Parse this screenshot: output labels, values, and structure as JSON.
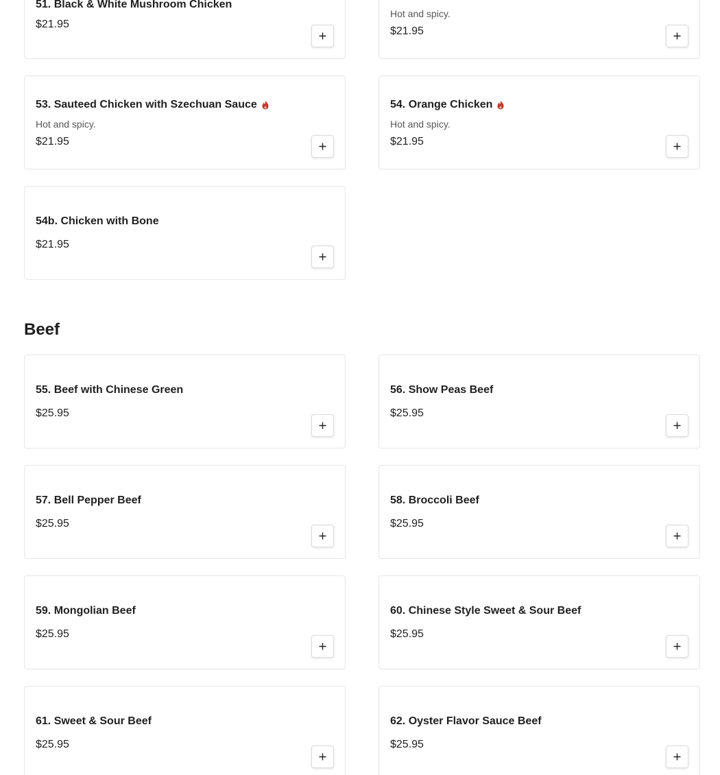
{
  "colors": {
    "spicy": "#c0392b",
    "border": "#e6e6e6",
    "text": "#1f1f1f"
  },
  "icons": {
    "add": "plus-icon",
    "spicy": "flame-icon"
  },
  "items": [
    {
      "name": "51. Black & White Mushroom Chicken",
      "price": "$21.95"
    },
    {
      "description": "Hot and spicy.",
      "price": "$21.95"
    },
    {
      "name": "53. Sauteed Chicken with Szechuan Sauce",
      "description": "Hot and spicy.",
      "price": "$21.95"
    },
    {
      "name": "54. Orange Chicken",
      "description": "Hot and spicy.",
      "price": "$21.95"
    },
    {
      "name": "54b. Chicken with Bone",
      "price": "$21.95"
    }
  ],
  "beef": {
    "title": "Beef",
    "items": [
      {
        "name": "55. Beef with Chinese Green",
        "price": "$25.95"
      },
      {
        "name": "56. Show Peas Beef",
        "price": "$25.95"
      },
      {
        "name": "57. Bell Pepper Beef",
        "price": "$25.95"
      },
      {
        "name": "58. Broccoli Beef",
        "price": "$25.95"
      },
      {
        "name": "59. Mongolian Beef",
        "price": "$25.95"
      },
      {
        "name": "60. Chinese Style Sweet & Sour Beef",
        "price": "$25.95"
      },
      {
        "name": "61. Sweet & Sour Beef",
        "price": "$25.95"
      },
      {
        "name": "62. Oyster Flavor Sauce Beef",
        "price": "$25.95"
      }
    ]
  }
}
